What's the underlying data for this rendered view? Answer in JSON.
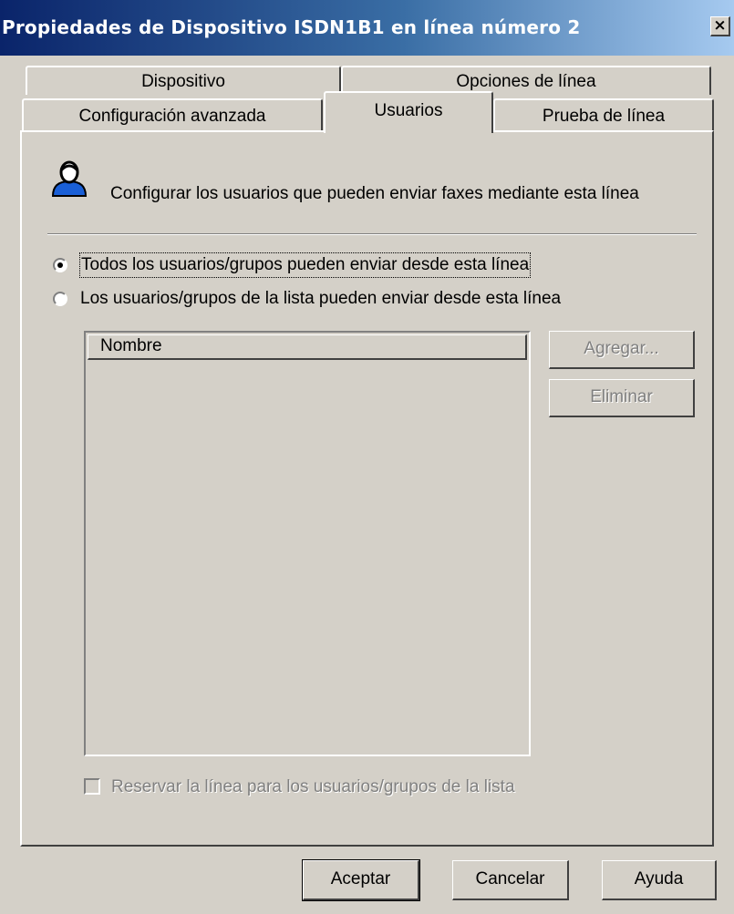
{
  "window": {
    "title": "Propiedades de Dispositivo ISDN1B1 en línea número 2",
    "close_glyph": "×"
  },
  "tabs": {
    "row1": [
      {
        "label": "Dispositivo"
      },
      {
        "label": "Opciones de línea"
      }
    ],
    "row2": [
      {
        "label": "Configuración avanzada"
      },
      {
        "label": "Usuarios",
        "selected": true
      },
      {
        "label": "Prueba de línea"
      }
    ]
  },
  "panel": {
    "header_icon": "user-icon",
    "description": "Configurar los usuarios que pueden enviar faxes mediante esta línea",
    "radio_all": {
      "label": "Todos los usuarios/grupos pueden enviar desde esta línea",
      "checked": true
    },
    "radio_list": {
      "label": "Los usuarios/grupos de la lista pueden enviar desde esta línea",
      "checked": false
    },
    "list": {
      "columns": [
        "Nombre"
      ],
      "rows": []
    },
    "add_button": "Agregar...",
    "remove_button": "Eliminar",
    "reserve_checkbox": {
      "label": "Reservar la línea para los usuarios/grupos de la lista",
      "checked": false,
      "enabled": false
    }
  },
  "footer": {
    "ok": "Aceptar",
    "cancel": "Cancelar",
    "help": "Ayuda"
  }
}
